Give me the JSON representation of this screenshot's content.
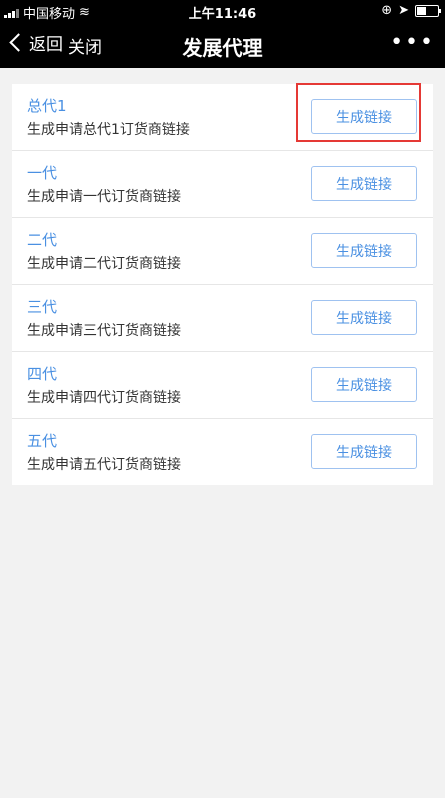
{
  "status_bar": {
    "carrier": "中国移动",
    "time": "上午11:46",
    "icons": [
      "signal-icon",
      "wifi-icon",
      "orientation-lock-icon",
      "location-icon",
      "battery-icon"
    ]
  },
  "nav": {
    "back_label": "返回",
    "close_label": "关闭",
    "title": "发展代理",
    "more_label": "•••"
  },
  "rows": [
    {
      "title": "总代1",
      "desc": "生成申请总代1订货商链接",
      "button": "生成链接"
    },
    {
      "title": "一代",
      "desc": "生成申请一代订货商链接",
      "button": "生成链接"
    },
    {
      "title": "二代",
      "desc": "生成申请二代订货商链接",
      "button": "生成链接"
    },
    {
      "title": "三代",
      "desc": "生成申请三代订货商链接",
      "button": "生成链接"
    },
    {
      "title": "四代",
      "desc": "生成申请四代订货商链接",
      "button": "生成链接"
    },
    {
      "title": "五代",
      "desc": "生成申请五代订货商链接",
      "button": "生成链接"
    }
  ],
  "colors": {
    "accent": "#4a90e2",
    "highlight": "#e53935",
    "background": "#f2f2f2"
  }
}
